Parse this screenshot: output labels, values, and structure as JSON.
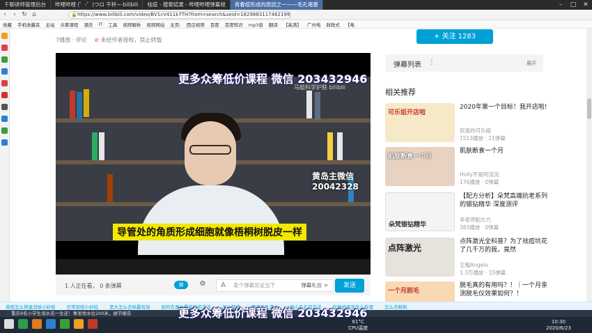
{
  "browser": {
    "tabs": [
      {
        "label": "千聊讲师管理后台",
        "active": false
      },
      {
        "label": "哔哩哔哩 (゜-゜)つロ 干杯~-bilibili",
        "active": false
      },
      {
        "label": "祛痘 - 搜索结果 - 哔哩哔哩弹幕视",
        "active": false
      },
      {
        "label": "青春痘形成的原因之一——毛孔堵塞",
        "active": true
      }
    ],
    "url": "https://www.bilibili.com/video/BV1cV411k7TH?from=search&seid=182988311746219905",
    "bookmarks": [
      "收藏",
      "手机收藏夹",
      "主站",
      "众筹课程",
      "潮去",
      "IT",
      "工具",
      "视频解析",
      "视频网站",
      "主页-",
      "西瓜视频",
      "百度",
      "百度知识",
      "mp3音",
      "翻译",
      "【高清】",
      "广州电",
      "财政式",
      "【电"
    ]
  },
  "video": {
    "meta_views": "7播放 · 评论",
    "meta_warning": "未经作者授权，禁止转载",
    "watermark": "马姐科学护肤 bilibili",
    "subtitle": "导管处的角质形成细胞就像梧桐树脱皮一样",
    "overlay_wechat": "黄岛主微信20042328",
    "promo_text": "更多众筹低价课程 微信 203432946",
    "follow_label": "+ 关注 1283"
  },
  "sendbar": {
    "viewers": "1 人正在看， 0 条弹幕",
    "toggle": "弹",
    "placeholder": "发个弹幕见证当下",
    "etiquette": "弹幕礼仪 >",
    "send_label": "发送"
  },
  "danmu": {
    "title": "弹幕列表",
    "more": "⋮",
    "expand": "展开"
  },
  "related": {
    "title": "相关推荐",
    "items": [
      {
        "title": "2020年第一个目标！我开店啦!",
        "uploader": "较真的可乐姐",
        "stats": "1513播放 · 21弹幕",
        "thumb_caption": "可乐姐开店啦",
        "thumb_bg": "#f5e9c8",
        "cap_color": "#d2392b"
      },
      {
        "title": "肌肤断食一个月",
        "uploader": "Holly不是阿浣浣",
        "stats": "176播放 · 0弹幕",
        "thumb_caption": "肌肤断食一个月",
        "thumb_bg": "#e8d2c2",
        "cap_color": "#ffffff"
      },
      {
        "title": "【配方分析】朵梵高端抗老系列的银钻精华 深度测评",
        "uploader": "李老师配方力",
        "stats": "383播放 · 0弹幕",
        "thumb_caption": "朵梵银钻精华",
        "thumb_bg": "#f4f4f4",
        "cap_color": "#333333"
      },
      {
        "title": "点阵激光全科普？为了祛痘坑花了几千万的我，竟然",
        "uploader": "王榴Angelo",
        "stats": "1.3万播放 · 15弹幕",
        "thumb_caption": "点阵激光",
        "thumb_bg": "#e6e2dc",
        "cap_color": "#222222"
      },
      {
        "title": "脱毛真的有用吗？！｜一个月亲测脱毛仪效果如何？！",
        "uploader": "",
        "stats": "",
        "thumb_caption": "一个月脱毛",
        "thumb_bg": "#f8d9b3",
        "cap_color": "#c0392b"
      }
    ]
  },
  "tags": [
    "痘痘怎么快速消除小妙招",
    "日常祛痘小妙招",
    "黑头怎么去除最有效",
    "如何去黑头最有效的方法",
    "怎么祛痘",
    "面部毛孔变大",
    "缩小毛孔的方法",
    "红肿痘痘该怎么处理",
    "怎么去粉刺"
  ],
  "taskbar": {
    "news": "重庆8名小学生溺水无一生还！事发地水位200米，据节报告",
    "weather_temp": "61°C",
    "weather_label": "CPU温度",
    "time": "10:30",
    "date": "2020/6/23"
  },
  "colors": {
    "accent": "#00a1d6",
    "subtitle_bg": "#f3e900",
    "warning": "#e84d4d"
  }
}
